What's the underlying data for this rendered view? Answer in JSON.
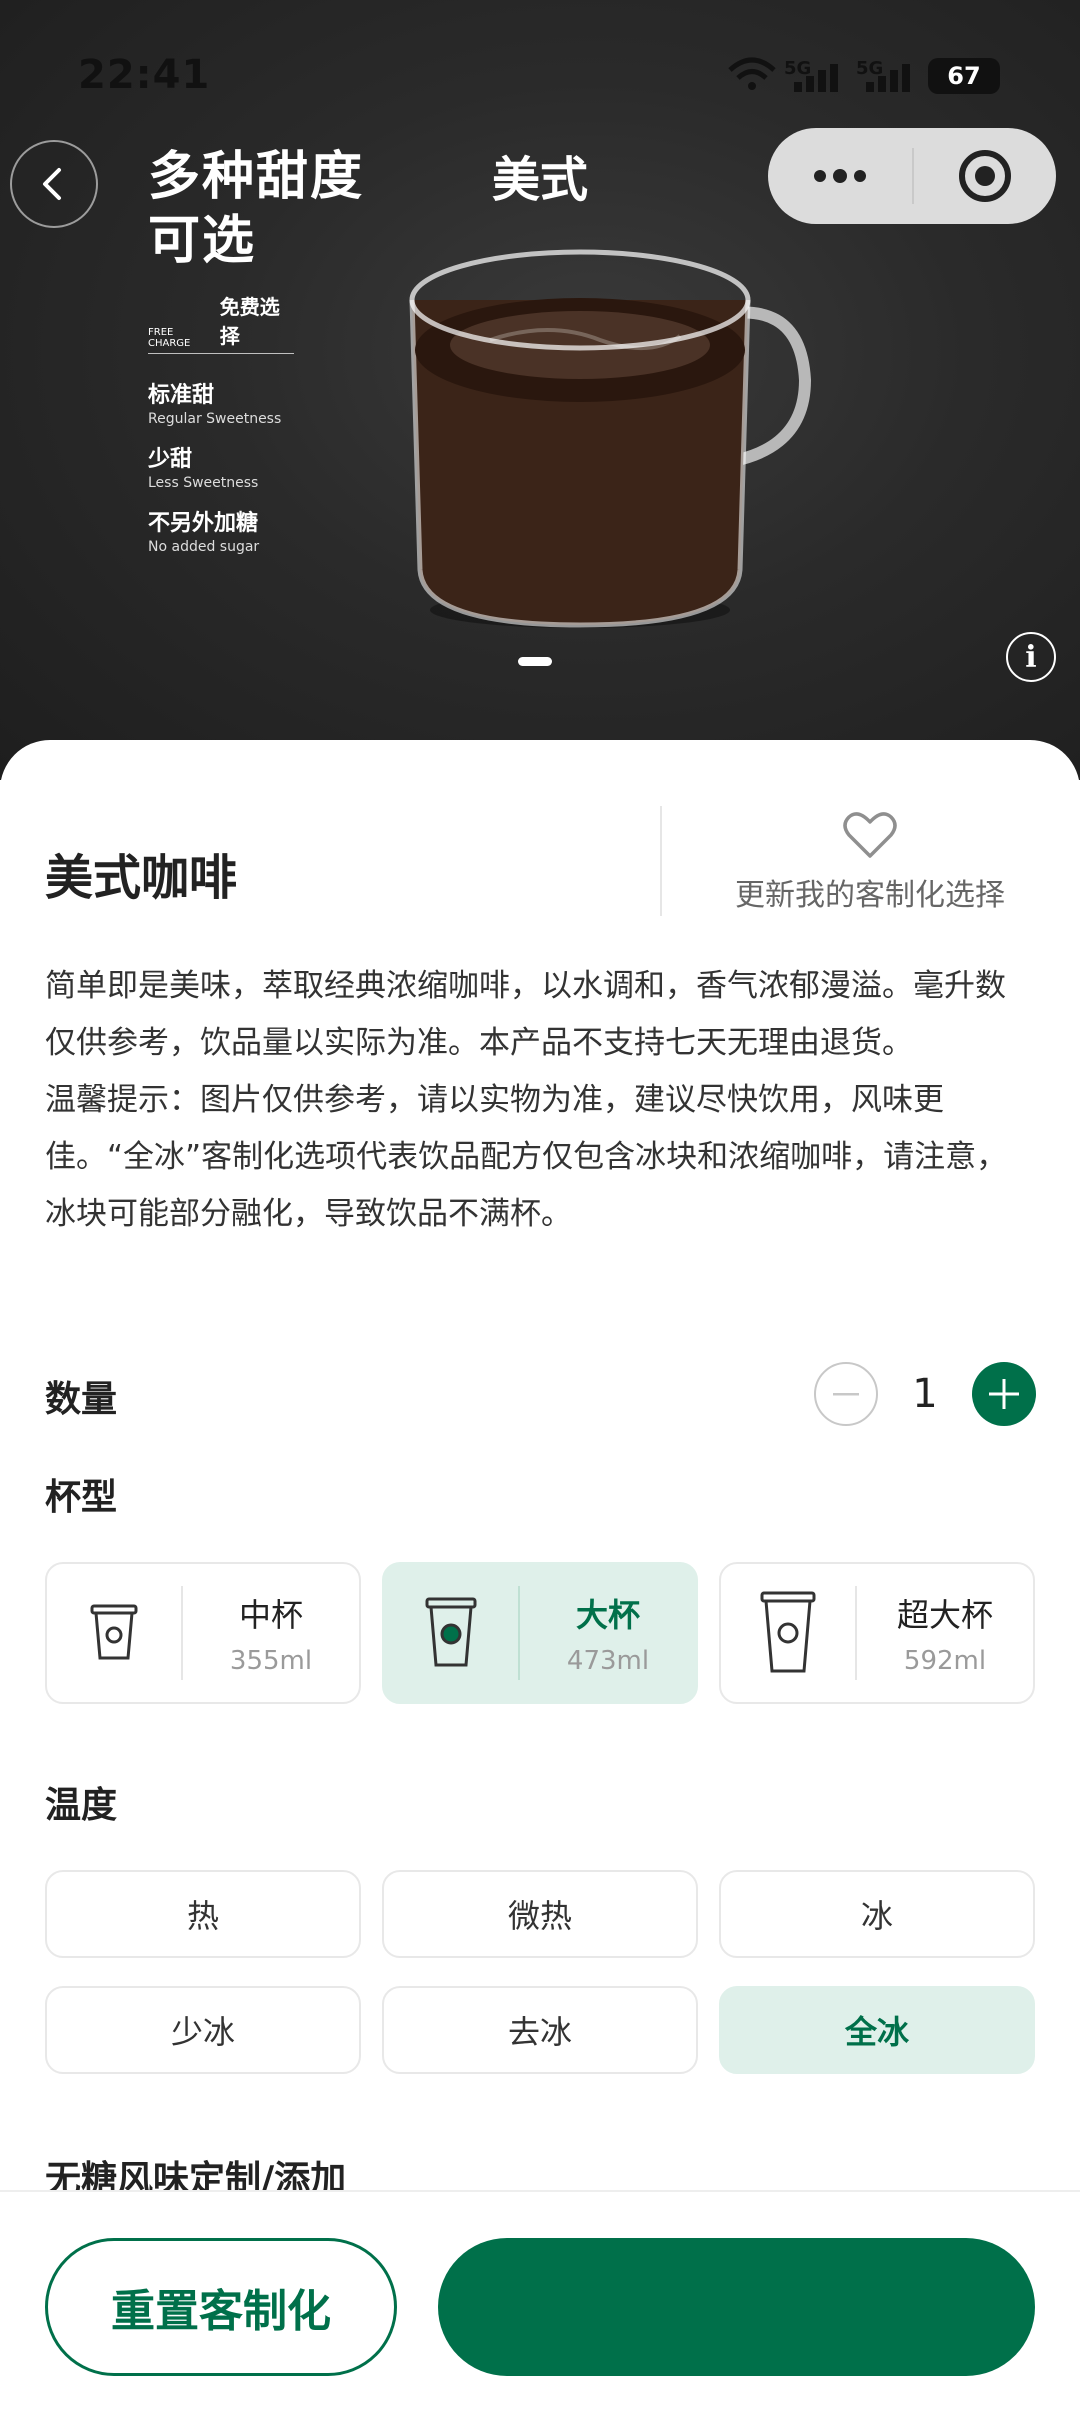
{
  "status_bar": {
    "time": "22:41",
    "signal_1": "5G",
    "signal_2": "5G",
    "battery": "67"
  },
  "header": {
    "title": "美式",
    "back_icon": "chevron-left-icon",
    "more_icon": "more-dots-icon",
    "target_icon": "target-icon"
  },
  "promo": {
    "headline_1": "多种甜度",
    "headline_2": "可选",
    "free_charge_en": "FREE CHARGE",
    "free_charge_cn": "免费选择",
    "options": [
      {
        "cn": "标准甜",
        "en": "Regular Sweetness"
      },
      {
        "cn": "少甜",
        "en": "Less Sweetness"
      },
      {
        "cn": "不另外加糖",
        "en": "No added sugar"
      }
    ]
  },
  "product": {
    "name": "美式咖啡",
    "favorite_label": "更新我的客制化选择",
    "description_1": "简单即是美味，萃取经典浓缩咖啡，以水调和，香气浓郁漫溢。毫升数仅供参考，饮品量以实际为准。本产品不支持七天无理由退货。",
    "description_2": "温馨提示：图片仅供参考，请以实物为准，建议尽快饮用，风味更佳。“全冰”客制化选项代表饮品配方仅包含冰块和浓缩咖啡，请注意，冰块可能部分融化，导致饮品不满杯。"
  },
  "quantity": {
    "label": "数量",
    "value": "1"
  },
  "cup_size": {
    "label": "杯型",
    "options": [
      {
        "name": "中杯",
        "volume": "355ml",
        "selected": false
      },
      {
        "name": "大杯",
        "volume": "473ml",
        "selected": true
      },
      {
        "name": "超大杯",
        "volume": "592ml",
        "selected": false
      }
    ]
  },
  "temperature": {
    "label": "温度",
    "options": [
      "热",
      "微热",
      "冰",
      "少冰",
      "去冰",
      "全冰"
    ],
    "selected": "全冰"
  },
  "next_section_label": "无糖风味定制/添加",
  "footer": {
    "reset_label": "重置客制化",
    "confirm_label": ""
  },
  "colors": {
    "brand_green": "#00704a",
    "selected_bg": "#dff0ea"
  }
}
